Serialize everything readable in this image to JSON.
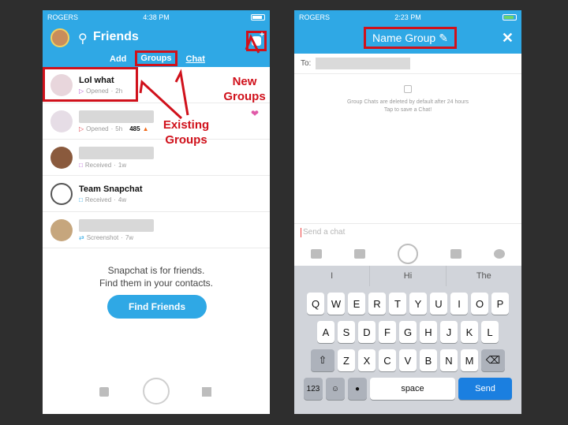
{
  "left": {
    "status": {
      "carrier": "ROGERS",
      "time": "4:38 PM"
    },
    "header": {
      "title": "Friends"
    },
    "tabs": [
      {
        "label": "Add"
      },
      {
        "label": "Groups"
      },
      {
        "label": "Chat"
      }
    ],
    "chats": [
      {
        "name": "Lol what",
        "status": "Opened",
        "age": "2h",
        "highlight": true
      },
      {
        "name": "",
        "status": "Opened",
        "age": "5h",
        "streak": "485"
      },
      {
        "name": "",
        "status": "Received",
        "age": "1w"
      },
      {
        "name": "Team Snapchat",
        "status": "Received",
        "age": "4w"
      },
      {
        "name": "",
        "status": "Screenshot",
        "age": "7w"
      }
    ],
    "empty_message": {
      "line1": "Snapchat is for friends.",
      "line2": "Find them in your contacts."
    },
    "find_friends_label": "Find Friends"
  },
  "annotations": {
    "new_groups": {
      "line1": "New",
      "line2": "Groups"
    },
    "existing_groups": {
      "line1": "Existing",
      "line2": "Groups"
    }
  },
  "right": {
    "status": {
      "carrier": "ROGERS",
      "time": "2:23 PM"
    },
    "header": {
      "title": "Name Group"
    },
    "to_label": "To:",
    "info": {
      "line1": "Group Chats are deleted by default after 24 hours",
      "line2": "Tap to save a Chat!"
    },
    "input_placeholder": "Send a chat",
    "suggestions": [
      "I",
      "Hi",
      "The"
    ],
    "keyboard": {
      "row1": [
        "Q",
        "W",
        "E",
        "R",
        "T",
        "Y",
        "U",
        "I",
        "O",
        "P"
      ],
      "row2": [
        "A",
        "S",
        "D",
        "F",
        "G",
        "H",
        "J",
        "K",
        "L"
      ],
      "row3": [
        "Z",
        "X",
        "C",
        "V",
        "B",
        "N",
        "M"
      ],
      "num_label": "123",
      "space_label": "space",
      "send_label": "Send"
    }
  },
  "colors": {
    "brand": "#2fa8e5",
    "annotation": "#d0111b"
  }
}
